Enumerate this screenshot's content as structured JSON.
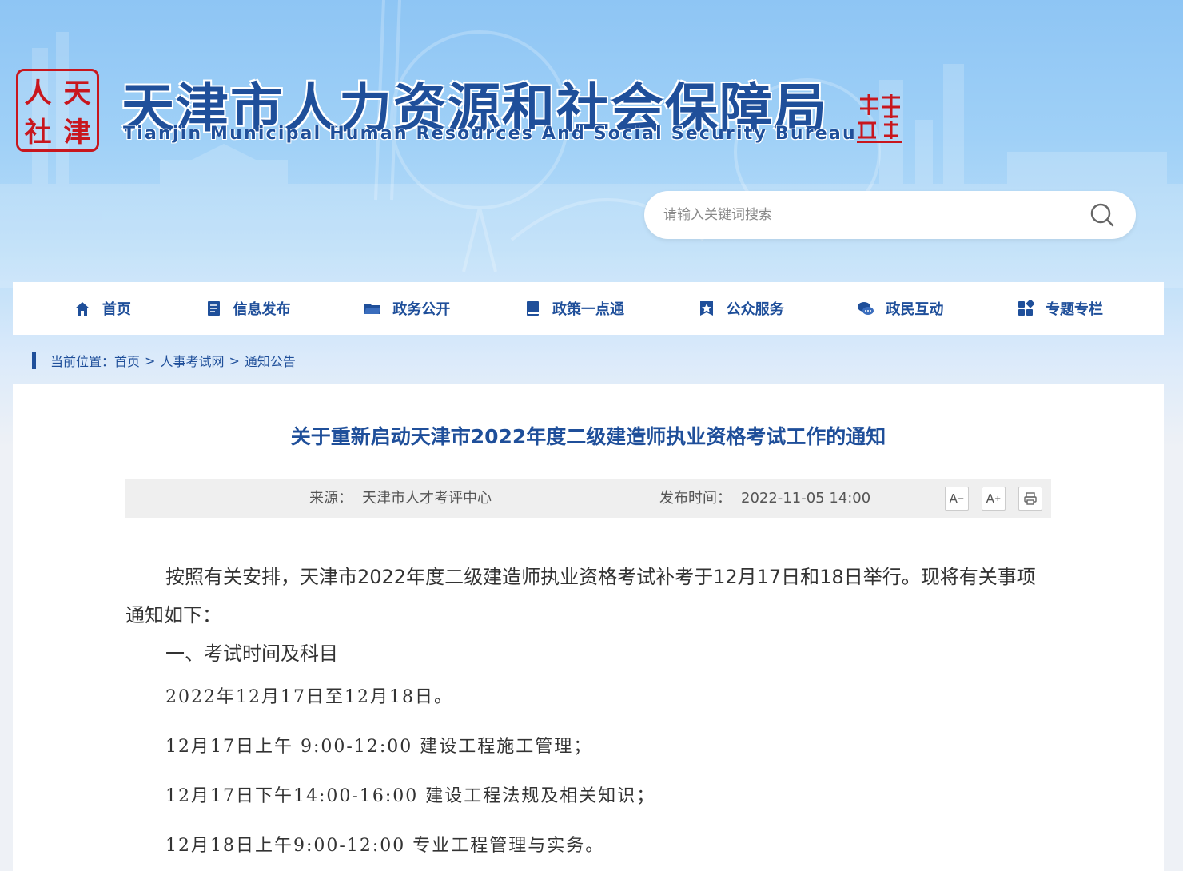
{
  "header": {
    "seal_chars": [
      "人",
      "天",
      "社",
      "津"
    ],
    "title": "天津市人力资源和社会保障局",
    "subtitle": "Tianjin Municipal Human Resources And Social Security Bureau",
    "brand_color": "#1f4f9a",
    "seal_color": "#c8161d"
  },
  "search": {
    "placeholder": "请输入关键词搜索"
  },
  "nav": {
    "items": [
      {
        "label": "首页",
        "icon": "home-icon"
      },
      {
        "label": "信息发布",
        "icon": "document-icon"
      },
      {
        "label": "政务公开",
        "icon": "folder-icon"
      },
      {
        "label": "政策一点通",
        "icon": "book-icon"
      },
      {
        "label": "公众服务",
        "icon": "star-badge-icon"
      },
      {
        "label": "政民互动",
        "icon": "chat-icon"
      },
      {
        "label": "专题专栏",
        "icon": "grid-icon"
      }
    ]
  },
  "breadcrumb": {
    "label": "当前位置：",
    "items": [
      "首页",
      "人事考试网",
      "通知公告"
    ],
    "sep": ">"
  },
  "article": {
    "title": "关于重新启动天津市2022年度二级建造师执业资格考试工作的通知",
    "source_label": "来源：",
    "source_value": "天津市人才考评中心",
    "time_label": "发布时间：",
    "time_value": "2022-11-05 14:00",
    "tools": {
      "font_smaller": "A",
      "font_larger": "A",
      "print_icon": "print-icon"
    },
    "lead": "按照有关安排，天津市2022年度二级建造师执业资格考试补考于12月17日和18日举行。现将有关事项通知如下：",
    "section1": "一、考试时间及科目",
    "lines": [
      "2022年12月17日至12月18日。",
      "12月17日上午 9:00-12:00 建设工程施工管理；",
      "12月17日下午14:00-16:00 建设工程法规及相关知识；",
      "12月18日上午9:00-12:00 专业工程管理与实务。"
    ]
  }
}
